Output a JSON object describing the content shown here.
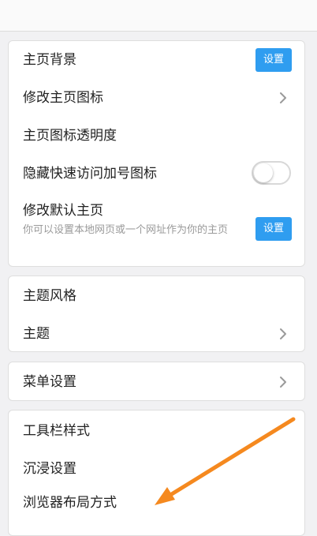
{
  "home_section": {
    "background": {
      "label": "主页背景",
      "button": "设置"
    },
    "change_icon": {
      "label": "修改主页图标"
    },
    "icon_opacity": {
      "label": "主页图标透明度"
    },
    "hide_plus": {
      "label": "隐藏快速访问加号图标"
    },
    "default_home": {
      "label": "修改默认主页",
      "description": "你可以设置本地网页或一个网址作为你的主页",
      "button": "设置"
    }
  },
  "theme_section": {
    "style": {
      "label": "主题风格"
    },
    "theme": {
      "label": "主题"
    }
  },
  "menu_section": {
    "menu": {
      "label": "菜单设置"
    }
  },
  "toolbar_section": {
    "toolbar_style": {
      "label": "工具栏样式"
    },
    "immersive": {
      "label": "沉浸设置"
    },
    "layout": {
      "label": "浏览器布局方式"
    }
  },
  "colors": {
    "accent": "#2f9df0",
    "annotation_arrow": "#f5891f"
  },
  "icons": [
    "chevron-right-icon",
    "toggle-switch",
    "arrow-annotation"
  ]
}
